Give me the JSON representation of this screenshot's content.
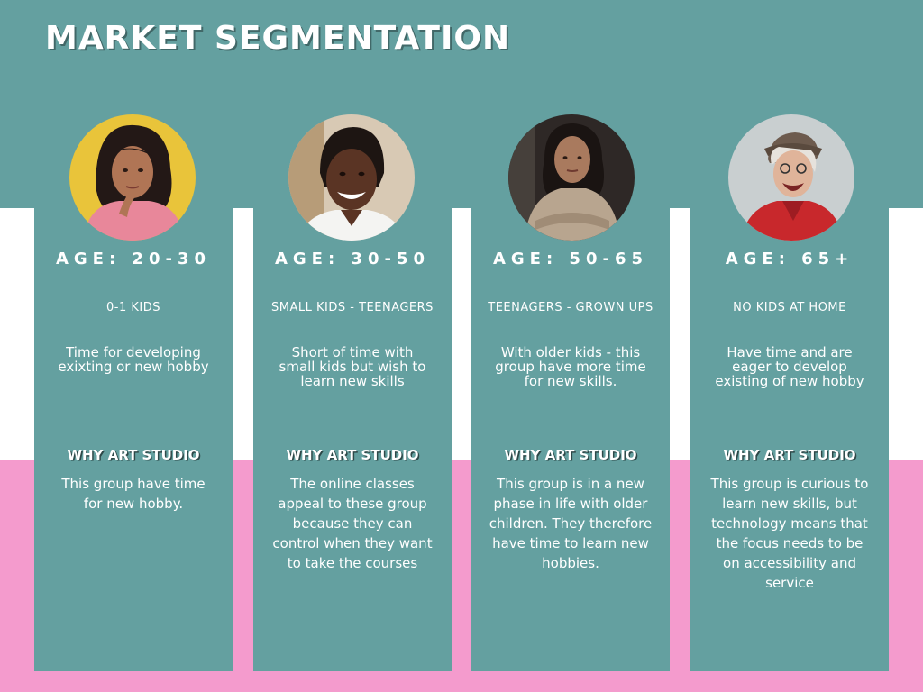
{
  "title": "MARKET SEGMENTATION",
  "colors": {
    "teal": "#64a0a0",
    "pink": "#f49bcd",
    "white": "#ffffff"
  },
  "segments": [
    {
      "age": "AGE: 20-30",
      "kids": "0-1 KIDS",
      "description": "Time for developing exixting or new hobby",
      "why_heading": "WHY ART STUDIO",
      "why_text": "This group have time for new hobby.",
      "photo": "woman-thinking-yellow-background"
    },
    {
      "age": "AGE: 30-50",
      "kids": "SMALL KIDS - TEENAGERS",
      "description": "Short of time with small kids but wish to learn new skills",
      "why_heading": "WHY ART STUDIO",
      "why_text": "The online classes appeal to these group because they can control when they want to take the courses",
      "photo": "smiling-woman-portrait"
    },
    {
      "age": "AGE: 50-65",
      "kids": "TEENAGERS - GROWN UPS",
      "description": "With older kids - this group have more time for new skills.",
      "why_heading": "WHY ART STUDIO",
      "why_text": "This group is in a new phase in life with older children. They therefore have time to learn new hobbies.",
      "photo": "woman-arms-crossed-dark-background"
    },
    {
      "age": "AGE: 65+",
      "kids": "NO KIDS AT HOME",
      "description": "Have time and are eager to develop existing of new hobby",
      "why_heading": "WHY ART STUDIO",
      "why_text": "This group is curious to learn new skills, but technology means that the focus needs to be on accessibility and service",
      "photo": "laughing-older-woman-cap"
    }
  ]
}
